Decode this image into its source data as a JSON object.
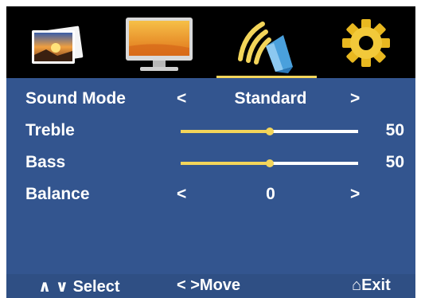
{
  "menu": {
    "tabs": [
      {
        "name": "picture",
        "icon": "picture-icon"
      },
      {
        "name": "screen",
        "icon": "monitor-icon"
      },
      {
        "name": "sound",
        "icon": "speaker-icon",
        "active": true
      },
      {
        "name": "setup",
        "icon": "gear-icon"
      }
    ],
    "active_tab": "sound"
  },
  "settings": {
    "sound_mode": {
      "label": "Sound Mode",
      "value": "Standard",
      "left": "<",
      "right": ">"
    },
    "treble": {
      "label": "Treble",
      "value": "50",
      "level": 0.5
    },
    "bass": {
      "label": "Bass",
      "value": "50",
      "level": 0.5
    },
    "balance": {
      "label": "Balance",
      "value": "0",
      "left": "<",
      "right": ">"
    }
  },
  "footer": {
    "select": "∧ ∨  Select",
    "move": "<  >Move",
    "exit": "⌂Exit"
  },
  "colors": {
    "panel": "#33558f",
    "footer": "#2f4f84",
    "accent": "#f3d55a",
    "topbar": "#000000"
  }
}
